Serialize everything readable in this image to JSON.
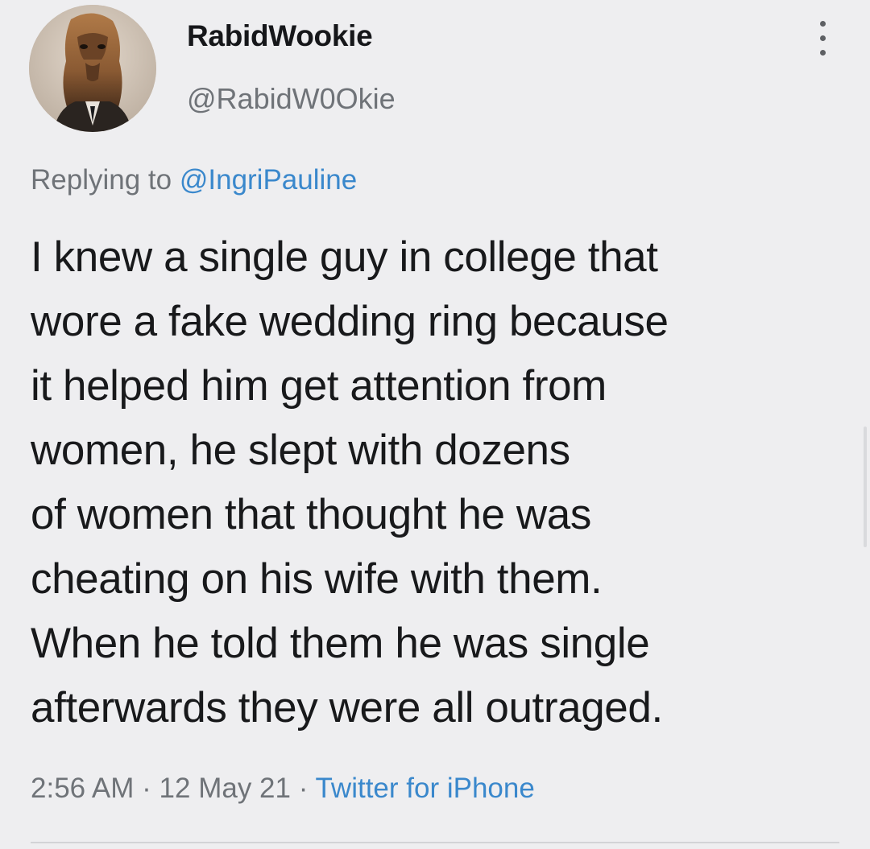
{
  "tweet": {
    "display_name": "RabidWookie",
    "handle": "@RabidW0Okie",
    "replying_prefix": "Replying to",
    "replying_to": "@IngriPauline",
    "text_lines": [
      "I knew a single guy in college that",
      "wore a fake wedding ring because",
      "it helped him get attention from",
      "women, he slept with dozens",
      "of women that thought he was",
      "cheating on his wife with them.",
      "When he told them he was single",
      "afterwards they were all outraged."
    ],
    "time": "2:56 AM",
    "separator": "·",
    "date": "12 May 21",
    "source": "Twitter for iPhone"
  },
  "icons": {
    "more": "more-vertical-icon",
    "avatar": "wookiee-avatar"
  },
  "colors": {
    "background": "#eeeef0",
    "text": "#18191b",
    "muted": "#6f7378",
    "link": "#3a88cc"
  }
}
